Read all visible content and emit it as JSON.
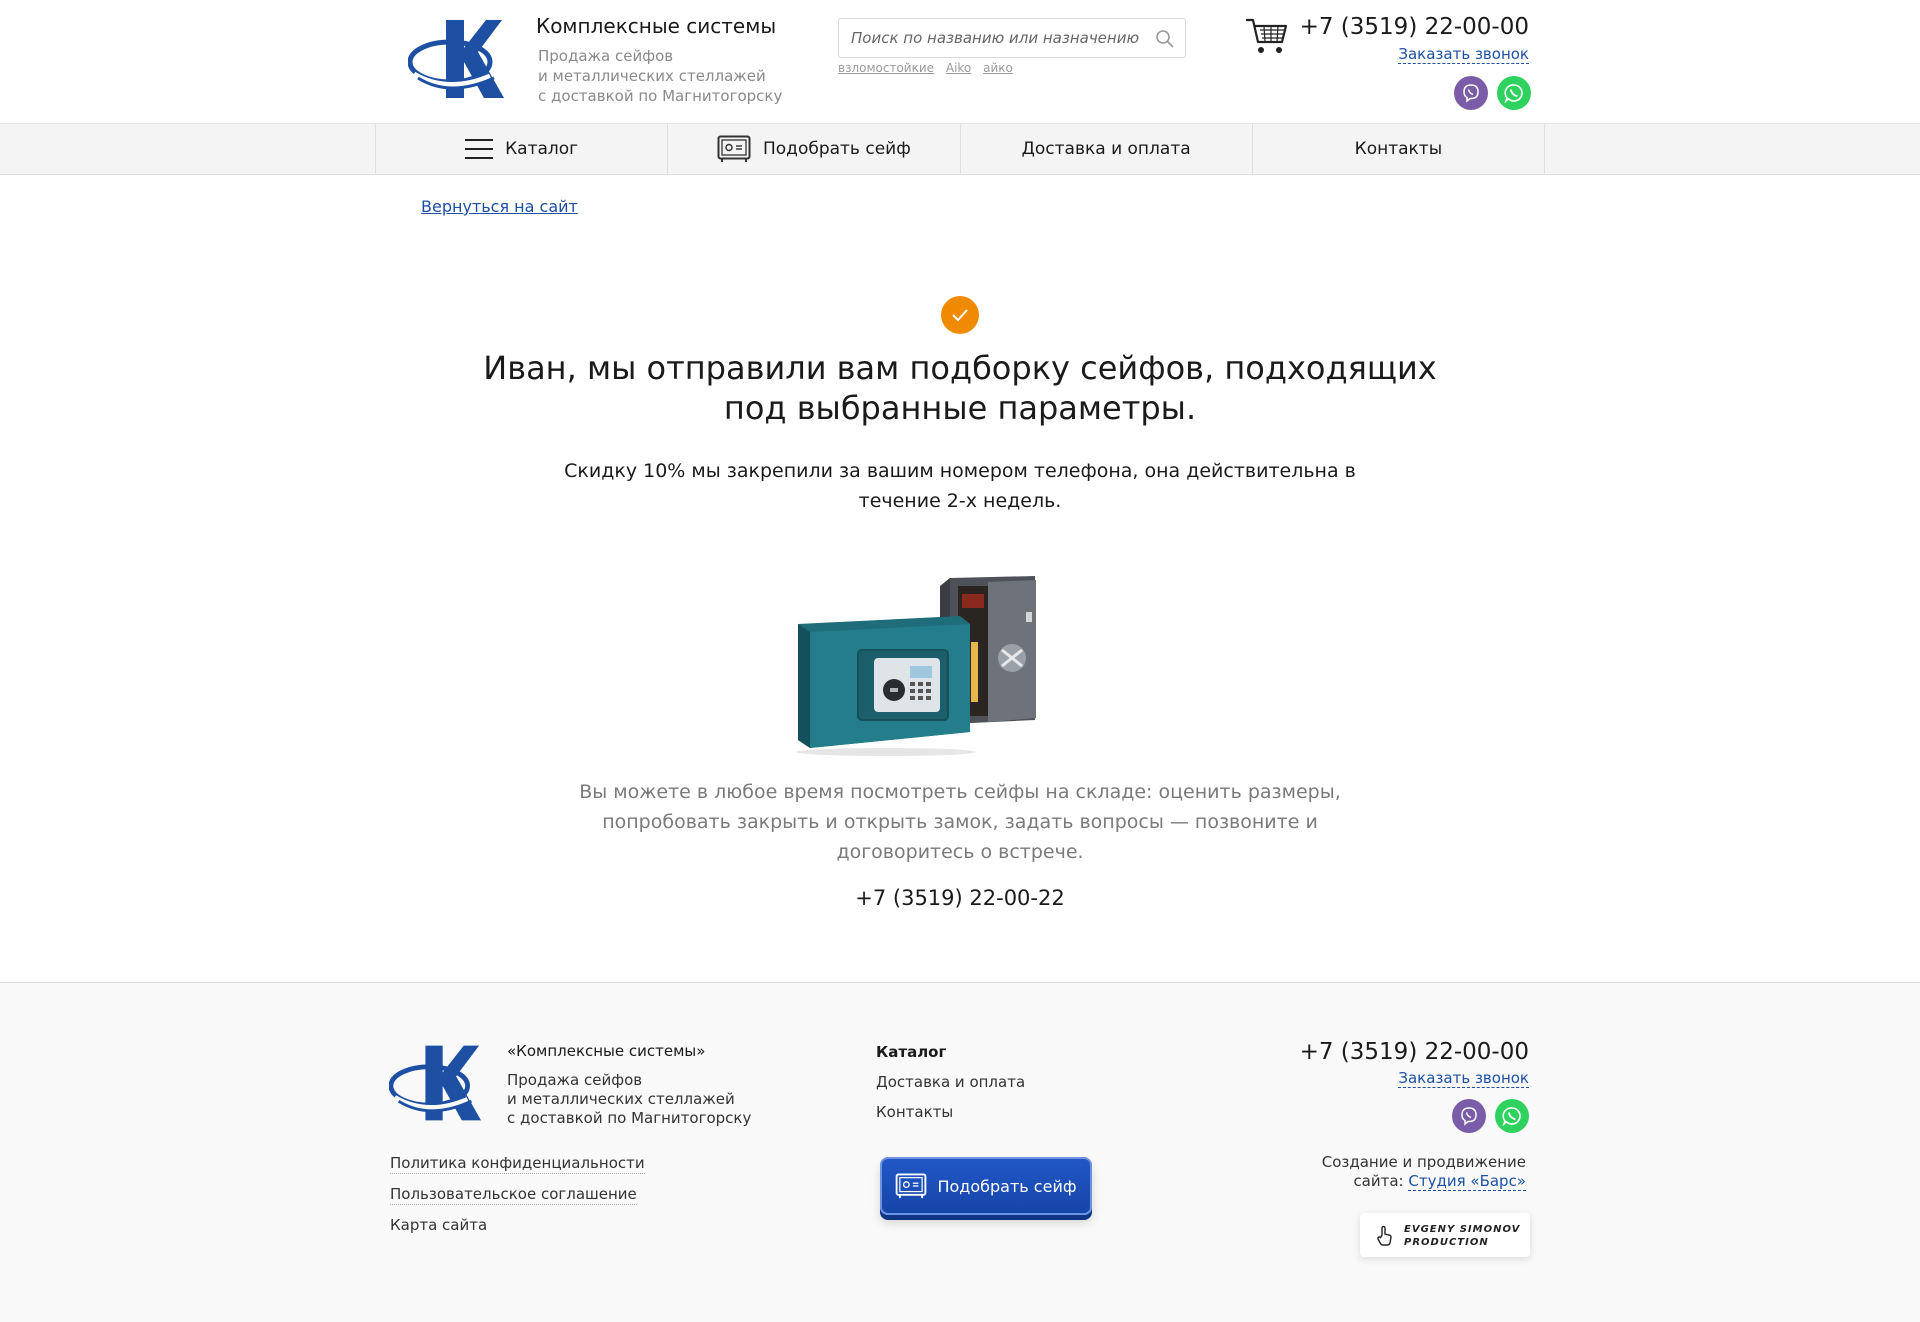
{
  "header": {
    "brand_title": "Комплексные системы",
    "brand_sub": "Продажа сейфов\nи металлических стеллажей\nс доставкой по Магнитогорску",
    "search_placeholder": "Поиск по названию или назначению",
    "search_tags": [
      "взломостойкие",
      "Aiko",
      "айко"
    ],
    "phone": "+7 (3519) 22-00-00",
    "callback": "Заказать звонок"
  },
  "nav": {
    "items": [
      {
        "label": "Каталог",
        "icon": "menu-icon"
      },
      {
        "label": "Подобрать сейф",
        "icon": "safe-icon"
      },
      {
        "label": "Доставка и оплата"
      },
      {
        "label": "Контакты"
      }
    ]
  },
  "main": {
    "back_link": "Вернуться на сайт",
    "headline": "Иван, мы отправили вам подборку сейфов, подходящих под выбранные параметры.",
    "subline": "Скидку 10% мы закрепили за вашим номером телефона, она действительна в течение 2-х недель.",
    "info": "Вы можете в любое время посмотреть сейфы на складе: оценить размеры, попробовать закрыть и открыть замок, задать вопросы — позвоните и договоритесь о встрече.",
    "phone": "+7 (3519) 22-00-22"
  },
  "footer": {
    "brand": "«Комплексные системы»",
    "brand_sub": "Продажа сейфов\nи металлических стеллажей\nс доставкой по Магнитогорску",
    "legal_links": [
      "Политика конфиденциальности",
      "Пользовательское соглашение",
      "Карта сайта"
    ],
    "nav_links": [
      "Каталог",
      "Доставка и оплата",
      "Контакты"
    ],
    "pick_button": "Подобрать сейф",
    "phone": "+7 (3519) 22-00-00",
    "callback": "Заказать звонок",
    "made_by_text": "Создание и продвижение",
    "made_by_prefix": "сайта:",
    "studio_link": "Студия «Барс»",
    "es_badge": "EVGENY SIMONOV\nPRODUCTION"
  },
  "colors": {
    "brand_blue": "#1d4fa3",
    "check_orange": "#f08a00",
    "viber": "#7a5ca8",
    "whatsapp": "#2fd25e"
  }
}
